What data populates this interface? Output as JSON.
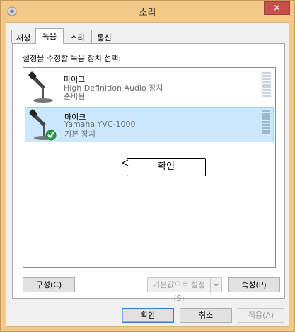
{
  "window": {
    "title": "소리",
    "close_label": "×"
  },
  "tabs": [
    {
      "label": "재생"
    },
    {
      "label": "녹음"
    },
    {
      "label": "소리"
    },
    {
      "label": "통신"
    }
  ],
  "panel": {
    "instruction": "설정을 수정할 녹음 장치 선택:"
  },
  "devices": [
    {
      "name": "마이크",
      "description": "High Definition Audio 장치",
      "status": "준비됨",
      "icon": "microphone-icon"
    },
    {
      "name": "마이크",
      "description": "Yamaha YVC-1000",
      "status": "기본 장치",
      "icon": "microphone-icon",
      "badge": "default-check-icon"
    }
  ],
  "callout": {
    "text": "확인"
  },
  "panel_buttons": {
    "configure": "구성(C)",
    "set_default": "기본값으로 설정(S)",
    "properties": "속성(P)"
  },
  "footer_buttons": {
    "ok": "확인",
    "cancel": "취소",
    "apply": "적용(A)"
  },
  "colors": {
    "frame": "#f3c98a",
    "close_button": "#c7504a",
    "selection": "#cce8ff",
    "default_check": "#2ea043"
  }
}
